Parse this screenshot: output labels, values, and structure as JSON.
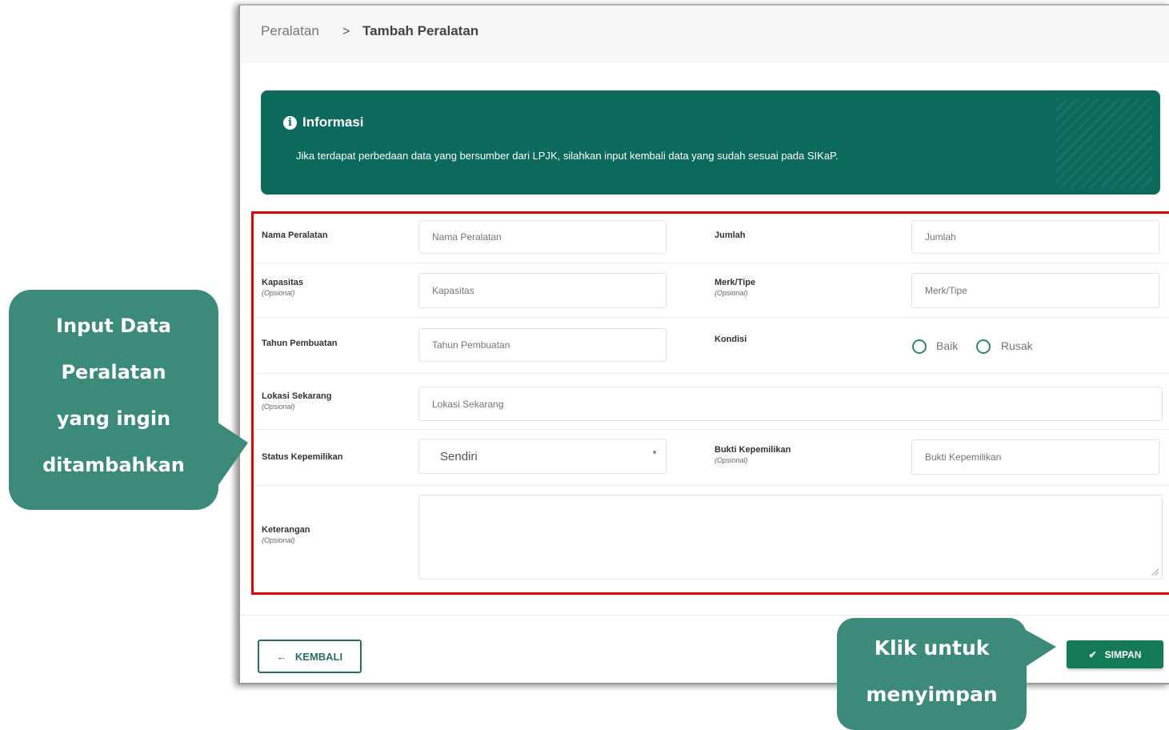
{
  "breadcrumb": {
    "parent": "Peralatan",
    "separator": ">",
    "current": "Tambah Peralatan"
  },
  "info": {
    "icon": "info-icon",
    "title": "Informasi",
    "message": "Jika terdapat perbedaan data yang bersumber dari LPJK, silahkan input kembali data yang sudah sesuai pada SIKaP."
  },
  "form": {
    "nama_peralatan": {
      "label": "Nama Peralatan",
      "placeholder": "Nama Peralatan"
    },
    "jumlah": {
      "label": "Jumlah",
      "placeholder": "Jumlah"
    },
    "kapasitas": {
      "label": "Kapasitas",
      "optional": "(Opsional)",
      "placeholder": "Kapasitas"
    },
    "merk_tipe": {
      "label": "Merk/Tipe",
      "optional": "(Opsional)",
      "placeholder": "Merk/Tipe"
    },
    "tahun_pembuatan": {
      "label": "Tahun Pembuatan",
      "placeholder": "Tahun Pembuatan"
    },
    "kondisi": {
      "label": "Kondisi",
      "options": [
        "Baik",
        "Rusak"
      ]
    },
    "lokasi_sekarang": {
      "label": "Lokasi Sekarang",
      "optional": "(Opsional)",
      "placeholder": "Lokasi Sekarang"
    },
    "status_kepemilikan": {
      "label": "Status Kepemilikan",
      "value": "Sendiri"
    },
    "bukti_kepemilikan": {
      "label": "Bukti Kepemilikan",
      "optional": "(Opsional)",
      "placeholder": "Bukti Kepemilikan"
    },
    "keterangan": {
      "label": "Keterangan",
      "optional": "(Opsional)"
    }
  },
  "buttons": {
    "back": {
      "label": "KEMBALI",
      "icon": "arrow-left-icon"
    },
    "save": {
      "label": "SIMPAN",
      "icon": "check-icon"
    }
  },
  "callouts": {
    "input": [
      "Input Data",
      "Peralatan",
      "yang ingin",
      "ditambahkan"
    ],
    "save": [
      "Klik untuk",
      "menyimpan"
    ]
  },
  "colors": {
    "primary": "#0c6a5c",
    "button_save": "#147a58",
    "callout": "#3b8a7a",
    "highlight_border": "#e00000"
  }
}
